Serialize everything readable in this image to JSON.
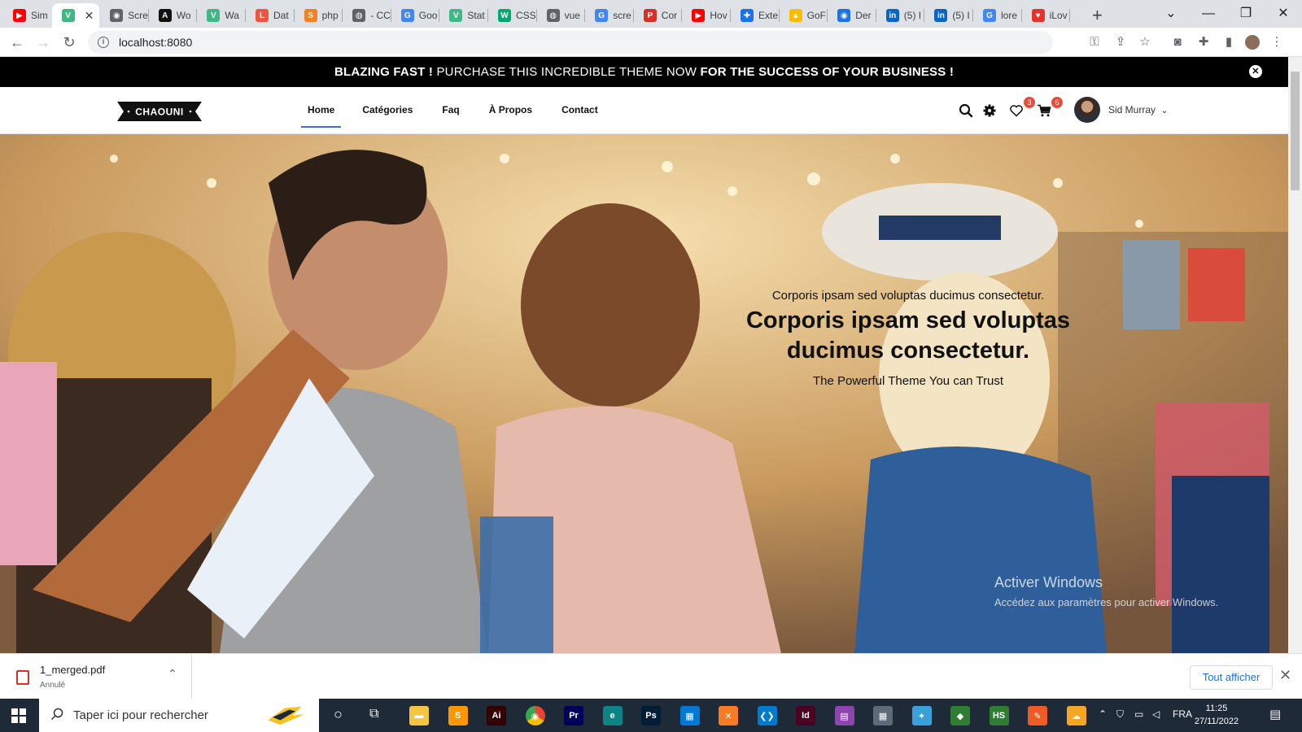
{
  "browser": {
    "tabs": [
      {
        "title": "Sim",
        "favicon": "youtube-icon",
        "color": "#ff0000",
        "glyph": "▶"
      },
      {
        "title": "",
        "favicon": "vue-icon",
        "color": "#41b883",
        "glyph": "V",
        "active": true
      },
      {
        "title": "Scre",
        "favicon": "camera-icon",
        "color": "#5f6368",
        "glyph": "◉"
      },
      {
        "title": "Wo",
        "favicon": "a-icon",
        "color": "#111111",
        "glyph": "A"
      },
      {
        "title": "Wa",
        "favicon": "vue-icon",
        "color": "#41b883",
        "glyph": "V"
      },
      {
        "title": "Dat",
        "favicon": "laravel-icon",
        "color": "#f05340",
        "glyph": "L"
      },
      {
        "title": "php",
        "favicon": "stackoverflow-icon",
        "color": "#f48024",
        "glyph": "S"
      },
      {
        "title": "- CC",
        "favicon": "globe-icon",
        "color": "#5f6368",
        "glyph": "◍"
      },
      {
        "title": "Goo",
        "favicon": "google-translate-icon",
        "color": "#4285f4",
        "glyph": "G"
      },
      {
        "title": "Stat",
        "favicon": "vue-icon",
        "color": "#41b883",
        "glyph": "V"
      },
      {
        "title": "CSS",
        "favicon": "w3schools-icon",
        "color": "#04aa6d",
        "glyph": "W"
      },
      {
        "title": "vue",
        "favicon": "globe-icon",
        "color": "#5f6368",
        "glyph": "◍"
      },
      {
        "title": "scre",
        "favicon": "google-icon",
        "color": "#4285f4",
        "glyph": "G"
      },
      {
        "title": "Cor",
        "favicon": "pdf-icon",
        "color": "#d93025",
        "glyph": "P"
      },
      {
        "title": "Hov",
        "favicon": "youtube-icon",
        "color": "#ff0000",
        "glyph": "▶"
      },
      {
        "title": "Exte",
        "favicon": "puzzle-icon",
        "color": "#1a73e8",
        "glyph": "✚"
      },
      {
        "title": "GoF",
        "favicon": "drive-icon",
        "color": "#fbbc04",
        "glyph": "▲"
      },
      {
        "title": "Der",
        "favicon": "camera-icon",
        "color": "#1a73e8",
        "glyph": "◉"
      },
      {
        "title": "(5) I",
        "favicon": "linkedin-icon",
        "color": "#0a66c2",
        "glyph": "in"
      },
      {
        "title": "(5) I",
        "favicon": "linkedin-icon",
        "color": "#0a66c2",
        "glyph": "in"
      },
      {
        "title": "lore",
        "favicon": "google-icon",
        "color": "#4285f4",
        "glyph": "G"
      },
      {
        "title": "iLov",
        "favicon": "heart-icon",
        "color": "#e5322d",
        "glyph": "♥"
      }
    ],
    "url": "localhost:8080"
  },
  "promo": {
    "bold1": "BLAZING FAST !",
    "middle": " PURCHASE THIS INCREDIBLE THEME NOW ",
    "bold2": "FOR THE SUCCESS OF YOUR BUSINESS !"
  },
  "header": {
    "logo": "CHAOUNI",
    "nav": [
      {
        "label": "Home",
        "active": true
      },
      {
        "label": "Catégories"
      },
      {
        "label": "Faq"
      },
      {
        "label": "À Propos"
      },
      {
        "label": "Contact"
      }
    ],
    "wishlist_count": "3",
    "cart_count": "6",
    "user_name": "Sid Murray"
  },
  "hero": {
    "kicker": "Corporis ipsam sed voluptas ducimus consectetur.",
    "title": "Corporis ipsam sed voluptas ducimus consectetur.",
    "subtitle": "The Powerful Theme You can Trust"
  },
  "watermark": {
    "line1": "Activer Windows",
    "line2": "Accédez aux paramètres pour activer Windows."
  },
  "download": {
    "filename": "1_merged.pdf",
    "status": "Annulé",
    "show_all": "Tout afficher"
  },
  "taskbar": {
    "search_placeholder": "Taper ici pour rechercher",
    "apps": [
      {
        "name": "file-explorer-icon",
        "color": "#f4c542",
        "glyph": "▬"
      },
      {
        "name": "sublime-text-icon",
        "color": "#ff9800",
        "glyph": "S"
      },
      {
        "name": "illustrator-icon",
        "color": "#330000",
        "glyph": "Ai"
      },
      {
        "name": "chrome-icon",
        "color": "#4285f4",
        "glyph": "◉"
      },
      {
        "name": "premiere-icon",
        "color": "#00005b",
        "glyph": "Pr"
      },
      {
        "name": "edge-icon",
        "color": "#0c8484",
        "glyph": "e"
      },
      {
        "name": "photoshop-icon",
        "color": "#001e36",
        "glyph": "Ps"
      },
      {
        "name": "store-icon",
        "color": "#0078d4",
        "glyph": "▦"
      },
      {
        "name": "xampp-icon",
        "color": "#fb7a24",
        "glyph": "✕"
      },
      {
        "name": "vscode-icon",
        "color": "#007acc",
        "glyph": "❮❯"
      },
      {
        "name": "indesign-icon",
        "color": "#49021f",
        "glyph": "Id"
      },
      {
        "name": "winrar-icon",
        "color": "#8e44ad",
        "glyph": "▤"
      },
      {
        "name": "calculator-icon",
        "color": "#5c6b7a",
        "glyph": "▦"
      },
      {
        "name": "bird-app-icon",
        "color": "#3aa0d8",
        "glyph": "✦"
      },
      {
        "name": "git-icon",
        "color": "#2e7d32",
        "glyph": "◆"
      },
      {
        "name": "hs-app-icon",
        "color": "#2e7d32",
        "glyph": "HS"
      },
      {
        "name": "postman-icon",
        "color": "#ef5b25",
        "glyph": "✎"
      },
      {
        "name": "weather-icon",
        "color": "#f5a623",
        "glyph": "☁"
      }
    ],
    "language": "FRA",
    "time": "11:25",
    "date": "27/11/2022"
  }
}
